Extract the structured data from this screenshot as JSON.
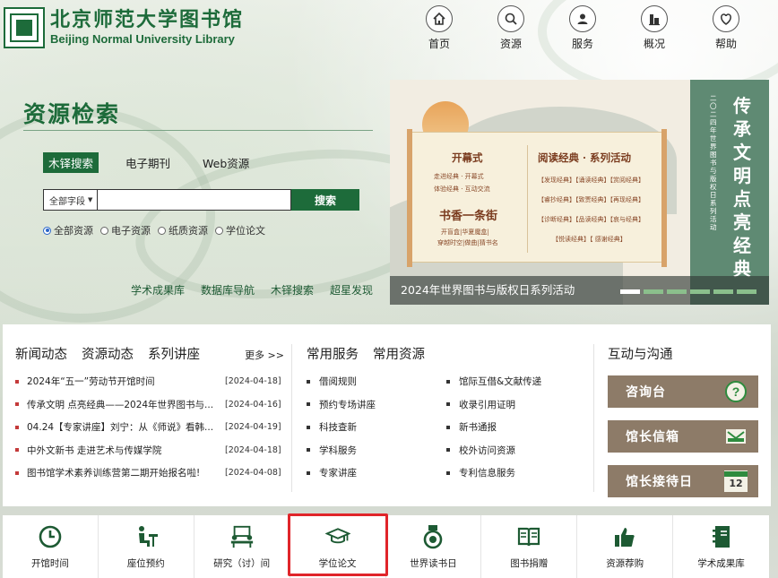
{
  "header": {
    "logo_cn": "北京师范大学图书馆",
    "logo_en": "Beijing Normal University Library",
    "nav": [
      {
        "label": "首页",
        "icon": "home-icon"
      },
      {
        "label": "资源",
        "icon": "search-icon"
      },
      {
        "label": "服务",
        "icon": "user-icon"
      },
      {
        "label": "概况",
        "icon": "building-icon"
      },
      {
        "label": "帮助",
        "icon": "heart-icon"
      }
    ]
  },
  "search": {
    "title": "资源检索",
    "tabs": [
      "木铎搜索",
      "电子期刊",
      "Web资源"
    ],
    "field_select": "全部字段",
    "input_value": "",
    "button": "搜索",
    "radios": [
      "全部资源",
      "电子资源",
      "纸质资源",
      "学位论文"
    ],
    "quick_links": [
      "学术成果库",
      "数据库导航",
      "木铎搜索",
      "超星发现"
    ]
  },
  "banner": {
    "caption": "2024年世界图书与版权日系列活动",
    "slides_total": 6,
    "active_slide": 1,
    "vertical_big": "传承文明点亮经典",
    "vertical_small": "二〇二四年世界图书与版权日系列活动",
    "scroll": {
      "h1": "开幕式",
      "h1_items": [
        "走进经典 · 开幕式",
        "体验经典 · 互动交流"
      ],
      "h2": "书香一条街",
      "h2_items": [
        "开盲盒|华夏魔盒|",
        "穿越时空|做曲|猜书名"
      ],
      "h3": "阅读经典 · 系列活动",
      "h3_items": [
        "【发现经典】【诵读经典】【赏阅经典】",
        "【睿抄经典】【致贾经典】【再现经典】",
        "【诊断经典】【品读经典】【哀与经典】",
        "【悦读经典】【 感谢经典】"
      ]
    }
  },
  "news": {
    "tabs": [
      "新闻动态",
      "资源动态",
      "系列讲座"
    ],
    "more": "更多 >>",
    "items": [
      {
        "title": "2024年“五一”劳动节开馆时间",
        "date": "[2024-04-18]"
      },
      {
        "title": "传承文明 点亮经典——2024年世界图书与...",
        "date": "[2024-04-16]"
      },
      {
        "title": "04.24【专家讲座】刘宁：从《师说》看韩...",
        "date": "[2024-04-19]"
      },
      {
        "title": "中外文新书 走进艺术与传媒学院",
        "date": "[2024-04-18]"
      },
      {
        "title": "图书馆学术素养训练营第二期开始报名啦!",
        "date": "[2024-04-08]"
      }
    ]
  },
  "services": {
    "tabs": [
      "常用服务",
      "常用资源"
    ],
    "items": [
      "借阅规则",
      "馆际互借&文献传递",
      "预约专场讲座",
      "收录引用证明",
      "科技查新",
      "新书通报",
      "学科服务",
      "校外访问资源",
      "专家讲座",
      "专利信息服务"
    ]
  },
  "interact": {
    "title": "互动与沟通",
    "buttons": [
      {
        "label": "咨询台",
        "icon": "question-icon"
      },
      {
        "label": "馆长信箱",
        "icon": "envelope-icon"
      },
      {
        "label": "馆长接待日",
        "icon": "calendar-icon",
        "calendar_day": "12"
      }
    ]
  },
  "bottom_bar": [
    {
      "label": "开馆时间",
      "icon": "clock-icon"
    },
    {
      "label": "座位预约",
      "icon": "seat-icon"
    },
    {
      "label": "研究（讨）间",
      "icon": "meeting-room-icon"
    },
    {
      "label": "学位论文",
      "icon": "graduation-cap-icon"
    },
    {
      "label": "世界读书日",
      "icon": "medal-icon"
    },
    {
      "label": "图书捐赠",
      "icon": "book-icon"
    },
    {
      "label": "资源荐购",
      "icon": "thumbs-up-icon"
    },
    {
      "label": "学术成果库",
      "icon": "notebook-icon"
    }
  ],
  "colors": {
    "brand_green": "#1d6b3a",
    "highlight_red": "#e0252a",
    "interact_brown": "#8d7b68"
  }
}
